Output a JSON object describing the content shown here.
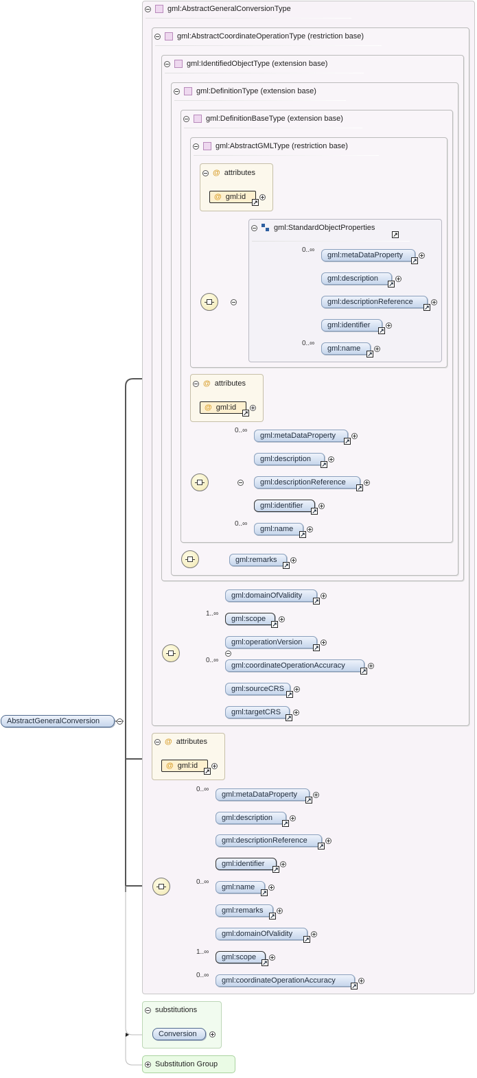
{
  "root_element": {
    "label": "AbstractGeneralConversion"
  },
  "types": {
    "t1": "gml:AbstractGeneralConversionType",
    "t2": "gml:AbstractCoordinateOperationType (restriction base)",
    "t3": "gml:IdentifiedObjectType (extension base)",
    "t4": "gml:DefinitionType (extension base)",
    "t5": "gml:DefinitionBaseType (extension base)",
    "t6": "gml:AbstractGMLType (restriction base)"
  },
  "attributes_label": "attributes",
  "attribute_id": "gml:id",
  "group_std": "gml:StandardObjectProperties",
  "std_elements": [
    "gml:metaDataProperty",
    "gml:description",
    "gml:descriptionReference",
    "gml:identifier",
    "gml:name"
  ],
  "cardinality": {
    "zero_many": "0..∞",
    "one_many": "1..∞"
  },
  "remarks": "gml:remarks",
  "op_elements": [
    "gml:domainOfValidity",
    "gml:scope",
    "gml:operationVersion",
    "gml:coordinateOperationAccuracy",
    "gml:sourceCRS",
    "gml:targetCRS"
  ],
  "final_elements": [
    "gml:metaDataProperty",
    "gml:description",
    "gml:descriptionReference",
    "gml:identifier",
    "gml:name",
    "gml:remarks",
    "gml:domainOfValidity",
    "gml:scope",
    "gml:coordinateOperationAccuracy"
  ],
  "substitutions": {
    "label": "substitutions",
    "item": "Conversion"
  },
  "substitution_group": "Substitution Group"
}
